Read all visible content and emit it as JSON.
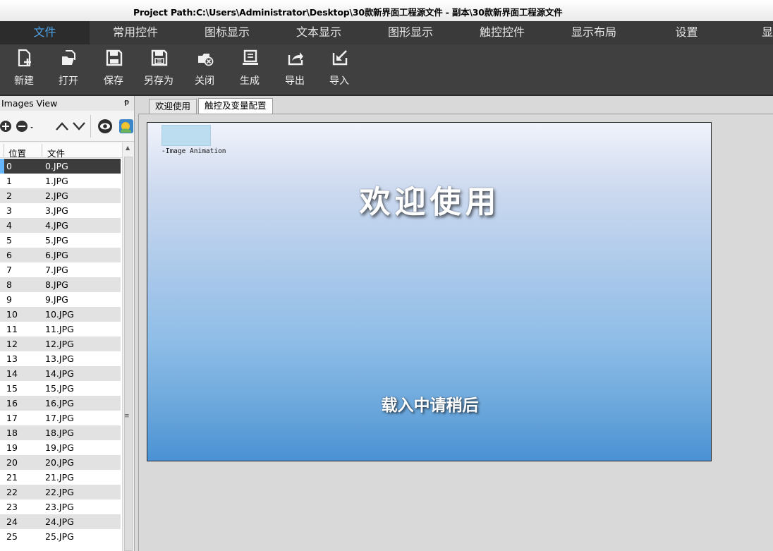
{
  "window": {
    "title": "Project Path:C:\\Users\\Administrator\\Desktop\\30款新界面工程源文件 - 副本\\30款新界面工程源文件"
  },
  "menu": {
    "tabs": [
      {
        "label": "文件",
        "active": true
      },
      {
        "label": "常用控件"
      },
      {
        "label": "图标显示"
      },
      {
        "label": "文本显示"
      },
      {
        "label": "图形显示"
      },
      {
        "label": "触控控件"
      },
      {
        "label": "显示布局"
      },
      {
        "label": "设置"
      },
      {
        "label": "显"
      }
    ]
  },
  "toolbar": {
    "new_label": "新建",
    "open_label": "打开",
    "save_label": "保存",
    "saveas_label": "另存为",
    "close_label": "关闭",
    "build_label": "生成",
    "export_label": "导出",
    "import_label": "导入"
  },
  "images_view": {
    "title": "Images View",
    "pin_glyph": "ᵽ",
    "columns": {
      "position": "位置",
      "file": "文件"
    },
    "rows": [
      {
        "pos": "0",
        "file": "0.JPG",
        "selected": true
      },
      {
        "pos": "1",
        "file": "1.JPG"
      },
      {
        "pos": "2",
        "file": "2.JPG"
      },
      {
        "pos": "3",
        "file": "3.JPG"
      },
      {
        "pos": "4",
        "file": "4.JPG"
      },
      {
        "pos": "5",
        "file": "5.JPG"
      },
      {
        "pos": "6",
        "file": "6.JPG"
      },
      {
        "pos": "7",
        "file": "7.JPG"
      },
      {
        "pos": "8",
        "file": "8.JPG"
      },
      {
        "pos": "9",
        "file": "9.JPG"
      },
      {
        "pos": "10",
        "file": "10.JPG"
      },
      {
        "pos": "11",
        "file": "11.JPG"
      },
      {
        "pos": "12",
        "file": "12.JPG"
      },
      {
        "pos": "13",
        "file": "13.JPG"
      },
      {
        "pos": "14",
        "file": "14.JPG"
      },
      {
        "pos": "15",
        "file": "15.JPG"
      },
      {
        "pos": "16",
        "file": "16.JPG"
      },
      {
        "pos": "17",
        "file": "17.JPG"
      },
      {
        "pos": "18",
        "file": "18.JPG"
      },
      {
        "pos": "19",
        "file": "19.JPG"
      },
      {
        "pos": "20",
        "file": "20.JPG"
      },
      {
        "pos": "21",
        "file": "21.JPG"
      },
      {
        "pos": "22",
        "file": "22.JPG"
      },
      {
        "pos": "23",
        "file": "23.JPG"
      },
      {
        "pos": "24",
        "file": "24.JPG"
      },
      {
        "pos": "25",
        "file": "25.JPG"
      }
    ]
  },
  "doc_tabs": [
    {
      "label": "欢迎使用"
    },
    {
      "label": "触控及变量配置",
      "active": true
    }
  ],
  "canvas": {
    "animation_label": "-Image Animation",
    "welcome_text": "欢迎使用",
    "loading_text": "载入中请稍后",
    "colors": {
      "top": "#f1f3fb",
      "bottom": "#4a91d4"
    }
  },
  "icons": [
    "new-file-icon",
    "open-folder-icon",
    "save-icon",
    "save-as-icon",
    "close-icon",
    "build-icon",
    "export-icon",
    "import-icon",
    "add-icon",
    "remove-icon",
    "up-icon",
    "down-icon",
    "eye-icon",
    "image-icon"
  ]
}
